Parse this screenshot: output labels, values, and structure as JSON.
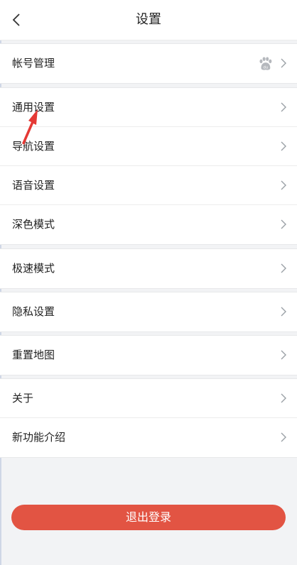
{
  "header": {
    "title": "设置"
  },
  "groups": [
    {
      "items": [
        {
          "label": "帐号管理"
        }
      ]
    },
    {
      "items": [
        {
          "label": "通用设置"
        },
        {
          "label": "导航设置"
        },
        {
          "label": "语音设置"
        },
        {
          "label": "深色模式"
        }
      ]
    },
    {
      "items": [
        {
          "label": "极速模式"
        }
      ]
    },
    {
      "items": [
        {
          "label": "隐私设置"
        }
      ]
    },
    {
      "items": [
        {
          "label": "重置地图"
        }
      ]
    },
    {
      "items": [
        {
          "label": "关于"
        },
        {
          "label": "新功能介绍"
        }
      ]
    }
  ],
  "logout_label": "退出登录",
  "colors": {
    "accent": "#e25443",
    "annotation": "#e53935"
  },
  "icons": [
    "back-arrow-icon",
    "chevron-right-icon",
    "paw-icon"
  ]
}
